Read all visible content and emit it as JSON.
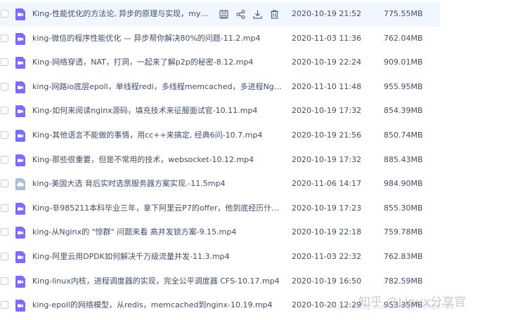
{
  "files": [
    {
      "name": "King-性能优化的方法论, 异步的原理与实现，mysql,...",
      "date": "2020-10-19 21:52",
      "size": "775.55MB",
      "icon": "video-icon",
      "selected": true
    },
    {
      "name": "king-微信的程序性能优化 — 异步帮你解决80%的问题-11.2.mp4",
      "date": "2020-11-03 11:36",
      "size": "762.04MB",
      "icon": "video-icon"
    },
    {
      "name": "King-网络穿透，NAT，打洞，一起来了解p2p的秘密-8.12.mp4",
      "date": "2020-10-19 22:24",
      "size": "909.01MB",
      "icon": "video-icon"
    },
    {
      "name": "king-网路io底层epoll，单线程redi，多线程memcached，多进程Nginx-...",
      "date": "2020-11-10 11:48",
      "size": "955.95MB",
      "icon": "video-icon"
    },
    {
      "name": "King-如何来阅读nginx源码，填充技术来征服面试官-10.11.mp4",
      "date": "2020-10-19 17:32",
      "size": "854.39MB",
      "icon": "video-icon"
    },
    {
      "name": "King-其他语言不能做的事情，用cc++来搞定, 经典6问-10.7.mp4",
      "date": "2020-10-19 21:56",
      "size": "850.74MB",
      "icon": "video-icon"
    },
    {
      "name": "King-那些很重要，但是不常用的技术，websocket-10.12.mp4",
      "date": "2020-10-19 17:32",
      "size": "885.43MB",
      "icon": "video-icon"
    },
    {
      "name": "king-美国大选 背后实时选票服务器方案实现.-11.5mp4",
      "date": "2020-11-06 14:17",
      "size": "984.90MB",
      "icon": "cloud-file-icon"
    },
    {
      "name": "King-非985211本科毕业三年，拿下阿里云P7的offer，他到底经历什么？...",
      "date": "2020-10-19 17:23",
      "size": "855.30MB",
      "icon": "video-icon"
    },
    {
      "name": "king-从Nginx的 \"惊群\" 问题来看 高并发锁方案-9.15.mp4",
      "date": "2020-10-19 22:18",
      "size": "759.78MB",
      "icon": "video-icon"
    },
    {
      "name": "King-阿里云用DPDK如何解决千万级流量并发-11.3.mp4",
      "date": "2020-11-03 22:32",
      "size": "762.83MB",
      "icon": "video-icon"
    },
    {
      "name": "King-linux内核，进程调度器的实现，完全公平调度器 CFS-10.17.mp4",
      "date": "2020-10-19 16:50",
      "size": "782.59MB",
      "icon": "video-icon"
    },
    {
      "name": "king-epoll的网络模型，从redis，memcached到nginx-10.19.mp4",
      "date": "2020-10-20 12:29",
      "size": "953.35MB",
      "icon": "video-icon"
    }
  ],
  "row_tools": [
    "save-icon",
    "share-icon",
    "download-icon",
    "delete-icon"
  ],
  "watermark": {
    "text": "知乎 @Linux分享官",
    "url": "https://blog.csdn.net/qq_40989769"
  },
  "colors": {
    "video_icon": "#7c6ef2",
    "cloud_icon": "#a9bfd6",
    "selected_row": "#f0f7ff",
    "text": "#424e67"
  }
}
